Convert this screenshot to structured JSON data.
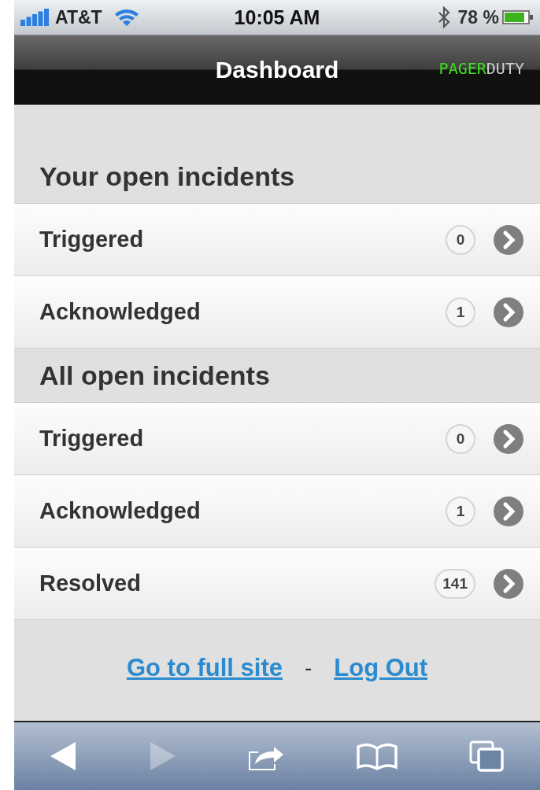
{
  "status_bar": {
    "carrier": "AT&T",
    "time": "10:05 AM",
    "battery": "78 %"
  },
  "nav_bar": {
    "title": "Dashboard",
    "logo": [
      "PAGER",
      "DUTY"
    ]
  },
  "sections": [
    {
      "title": "Your open incidents",
      "rows": [
        {
          "label": "Triggered",
          "count": "0"
        },
        {
          "label": "Acknowledged",
          "count": "1"
        }
      ]
    },
    {
      "title": "All open incidents",
      "rows": [
        {
          "label": "Triggered",
          "count": "0"
        },
        {
          "label": "Acknowledged",
          "count": "1"
        },
        {
          "label": "Resolved",
          "count": "141"
        }
      ]
    }
  ],
  "footer": {
    "links": [
      "Go to full site",
      "Log Out"
    ],
    "separator": "-"
  },
  "toolbar": {
    "back_disabled": false,
    "forward_disabled": true
  }
}
